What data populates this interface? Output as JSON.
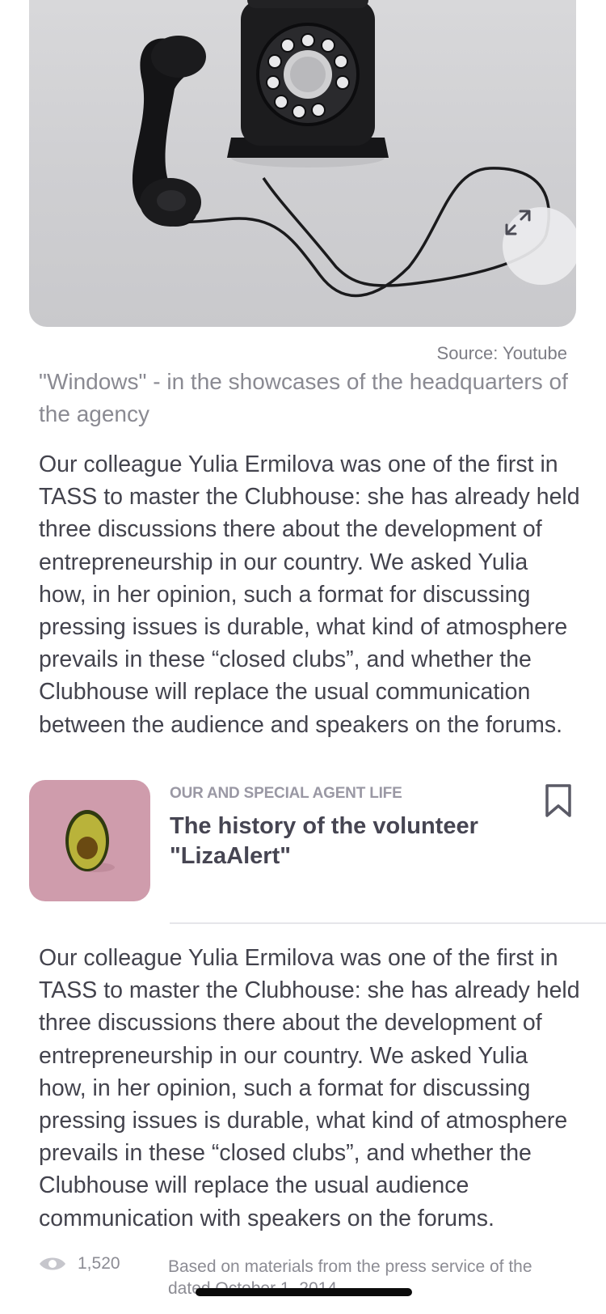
{
  "article": {
    "image_source": "Source: Youtube",
    "image_caption": "\"Windows\" - in the showcases of the headquarters of the agency",
    "paragraph_1": "Our colleague Yulia Ermilova was one of the first in TASS to master the Clubhouse: she has already held three discussions there about the development of entrepreneurship in our country. We asked Yulia how, in her opinion, such a format for discussing pressing issues is durable, what kind of atmosphere prevails in these “closed clubs”, and whether the Clubhouse will replace the usual communication between the audience and speakers on the forums.",
    "paragraph_2": "Our colleague Yulia Ermilova was one of the first in TASS to master the Clubhouse: she has already held three discussions there about the development of entrepreneurship in our country. We asked Yulia how, in her opinion, such a format for discussing pressing issues is durable, what kind of atmosphere prevails in these “closed clubs”, and whether the Clubhouse will replace the usual audience communication with speakers on the forums."
  },
  "related_card": {
    "category": "OUR AND SPECIAL AGENT LIFE",
    "title": "The history of the volunteer \"LizaAlert\"",
    "thumb_color": "#cf9cac",
    "bookmark_icon": "bookmark-icon"
  },
  "footer": {
    "views_count": "1,520",
    "views_icon": "eye-icon",
    "source_note": "Based on materials from the press service of the dated October 1, 2014"
  },
  "icons": {
    "expand": "expand-icon"
  }
}
